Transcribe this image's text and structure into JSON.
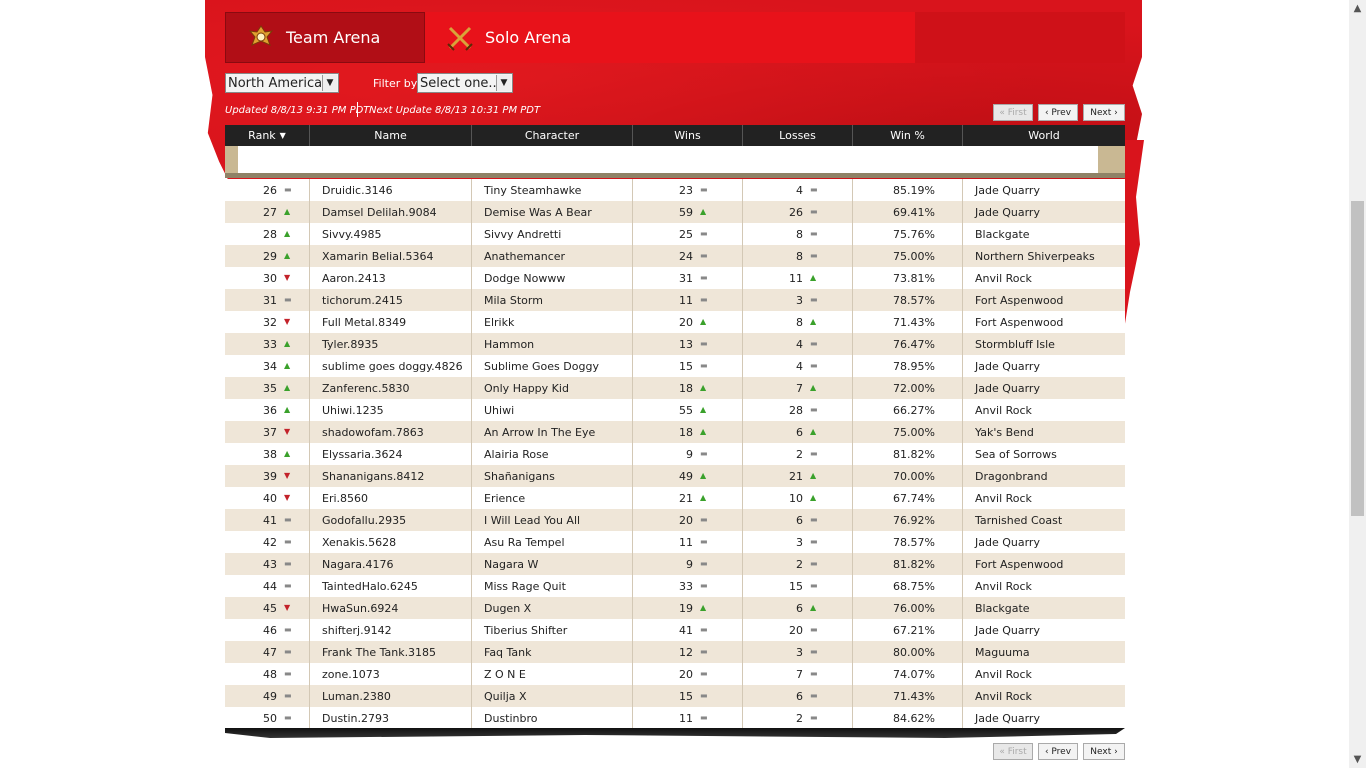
{
  "tabs": [
    {
      "label": "Team Arena"
    },
    {
      "label": "Solo Arena"
    }
  ],
  "filters": {
    "region_value": "North America",
    "filter_label": "Filter by:",
    "filter_value": "Select one..."
  },
  "status": {
    "updated": "Updated 8/8/13 9:31 PM PDT",
    "next_update": "Next Update 8/8/13 10:31 PM PDT"
  },
  "pager": {
    "first": "« First",
    "prev": "‹ Prev",
    "next": "Next ›"
  },
  "columns": [
    "Rank",
    "Name",
    "Character",
    "Wins",
    "Losses",
    "Win %",
    "World"
  ],
  "rows": [
    {
      "rank": "26",
      "rank_trend": "same",
      "name": "Druidic.3146",
      "character": "Tiny Steamhawke",
      "wins": "23",
      "wins_trend": "same",
      "losses": "4",
      "losses_trend": "same",
      "pct": "85.19%",
      "world": "Jade Quarry"
    },
    {
      "rank": "27",
      "rank_trend": "up",
      "name": "Damsel Delilah.9084",
      "character": "Demise Was A Bear",
      "wins": "59",
      "wins_trend": "up",
      "losses": "26",
      "losses_trend": "same",
      "pct": "69.41%",
      "world": "Jade Quarry"
    },
    {
      "rank": "28",
      "rank_trend": "up",
      "name": "Sivvy.4985",
      "character": "Sivvy Andretti",
      "wins": "25",
      "wins_trend": "same",
      "losses": "8",
      "losses_trend": "same",
      "pct": "75.76%",
      "world": "Blackgate"
    },
    {
      "rank": "29",
      "rank_trend": "up",
      "name": "Xamarin Belial.5364",
      "character": "Anathemancer",
      "wins": "24",
      "wins_trend": "same",
      "losses": "8",
      "losses_trend": "same",
      "pct": "75.00%",
      "world": "Northern Shiverpeaks"
    },
    {
      "rank": "30",
      "rank_trend": "down",
      "name": "Aaron.2413",
      "character": "Dodge Nowww",
      "wins": "31",
      "wins_trend": "same",
      "losses": "11",
      "losses_trend": "up",
      "pct": "73.81%",
      "world": "Anvil Rock"
    },
    {
      "rank": "31",
      "rank_trend": "same",
      "name": "tichorum.2415",
      "character": "Mila Storm",
      "wins": "11",
      "wins_trend": "same",
      "losses": "3",
      "losses_trend": "same",
      "pct": "78.57%",
      "world": "Fort Aspenwood"
    },
    {
      "rank": "32",
      "rank_trend": "down",
      "name": "Full Metal.8349",
      "character": "Elrikk",
      "wins": "20",
      "wins_trend": "up",
      "losses": "8",
      "losses_trend": "up",
      "pct": "71.43%",
      "world": "Fort Aspenwood"
    },
    {
      "rank": "33",
      "rank_trend": "up",
      "name": "Tyler.8935",
      "character": "Hammon",
      "wins": "13",
      "wins_trend": "same",
      "losses": "4",
      "losses_trend": "same",
      "pct": "76.47%",
      "world": "Stormbluff Isle"
    },
    {
      "rank": "34",
      "rank_trend": "up",
      "name": "sublime goes doggy.4826",
      "character": "Sublime Goes Doggy",
      "wins": "15",
      "wins_trend": "same",
      "losses": "4",
      "losses_trend": "same",
      "pct": "78.95%",
      "world": "Jade Quarry"
    },
    {
      "rank": "35",
      "rank_trend": "up",
      "name": "Zanferenc.5830",
      "character": "Only Happy Kid",
      "wins": "18",
      "wins_trend": "up",
      "losses": "7",
      "losses_trend": "up",
      "pct": "72.00%",
      "world": "Jade Quarry"
    },
    {
      "rank": "36",
      "rank_trend": "up",
      "name": "Uhiwi.1235",
      "character": "Uhiwi",
      "wins": "55",
      "wins_trend": "up",
      "losses": "28",
      "losses_trend": "same",
      "pct": "66.27%",
      "world": "Anvil Rock"
    },
    {
      "rank": "37",
      "rank_trend": "down",
      "name": "shadowofam.7863",
      "character": "An Arrow In The Eye",
      "wins": "18",
      "wins_trend": "up",
      "losses": "6",
      "losses_trend": "up",
      "pct": "75.00%",
      "world": "Yak's Bend"
    },
    {
      "rank": "38",
      "rank_trend": "up",
      "name": "Elyssaria.3624",
      "character": "Alairia Rose",
      "wins": "9",
      "wins_trend": "same",
      "losses": "2",
      "losses_trend": "same",
      "pct": "81.82%",
      "world": "Sea of Sorrows"
    },
    {
      "rank": "39",
      "rank_trend": "down",
      "name": "Shananigans.8412",
      "character": "Shañanigans",
      "wins": "49",
      "wins_trend": "up",
      "losses": "21",
      "losses_trend": "up",
      "pct": "70.00%",
      "world": "Dragonbrand"
    },
    {
      "rank": "40",
      "rank_trend": "down",
      "name": "Eri.8560",
      "character": "Erience",
      "wins": "21",
      "wins_trend": "up",
      "losses": "10",
      "losses_trend": "up",
      "pct": "67.74%",
      "world": "Anvil Rock"
    },
    {
      "rank": "41",
      "rank_trend": "same",
      "name": "Godofallu.2935",
      "character": "I Will Lead You All",
      "wins": "20",
      "wins_trend": "same",
      "losses": "6",
      "losses_trend": "same",
      "pct": "76.92%",
      "world": "Tarnished Coast"
    },
    {
      "rank": "42",
      "rank_trend": "same",
      "name": "Xenakis.5628",
      "character": "Asu Ra Tempel",
      "wins": "11",
      "wins_trend": "same",
      "losses": "3",
      "losses_trend": "same",
      "pct": "78.57%",
      "world": "Jade Quarry"
    },
    {
      "rank": "43",
      "rank_trend": "same",
      "name": "Nagara.4176",
      "character": "Nagara W",
      "wins": "9",
      "wins_trend": "same",
      "losses": "2",
      "losses_trend": "same",
      "pct": "81.82%",
      "world": "Fort Aspenwood"
    },
    {
      "rank": "44",
      "rank_trend": "same",
      "name": "TaintedHalo.6245",
      "character": "Miss Rage Quit",
      "wins": "33",
      "wins_trend": "same",
      "losses": "15",
      "losses_trend": "same",
      "pct": "68.75%",
      "world": "Anvil Rock"
    },
    {
      "rank": "45",
      "rank_trend": "down",
      "name": "HwaSun.6924",
      "character": "Dugen X",
      "wins": "19",
      "wins_trend": "up",
      "losses": "6",
      "losses_trend": "up",
      "pct": "76.00%",
      "world": "Blackgate"
    },
    {
      "rank": "46",
      "rank_trend": "same",
      "name": "shifterj.9142",
      "character": "Tiberius Shifter",
      "wins": "41",
      "wins_trend": "same",
      "losses": "20",
      "losses_trend": "same",
      "pct": "67.21%",
      "world": "Jade Quarry"
    },
    {
      "rank": "47",
      "rank_trend": "same",
      "name": "Frank The Tank.3185",
      "character": "Faq Tank",
      "wins": "12",
      "wins_trend": "same",
      "losses": "3",
      "losses_trend": "same",
      "pct": "80.00%",
      "world": "Maguuma"
    },
    {
      "rank": "48",
      "rank_trend": "same",
      "name": "zone.1073",
      "character": "Z O N E",
      "wins": "20",
      "wins_trend": "same",
      "losses": "7",
      "losses_trend": "same",
      "pct": "74.07%",
      "world": "Anvil Rock"
    },
    {
      "rank": "49",
      "rank_trend": "same",
      "name": "Luman.2380",
      "character": "Quilja X",
      "wins": "15",
      "wins_trend": "same",
      "losses": "6",
      "losses_trend": "same",
      "pct": "71.43%",
      "world": "Anvil Rock"
    },
    {
      "rank": "50",
      "rank_trend": "same",
      "name": "Dustin.2793",
      "character": "Dustinbro",
      "wins": "11",
      "wins_trend": "same",
      "losses": "2",
      "losses_trend": "same",
      "pct": "84.62%",
      "world": "Jade Quarry"
    }
  ],
  "colors": {
    "banner_red": "#d9141c",
    "trend_up": "#3aa12b",
    "trend_down": "#c3222a"
  }
}
